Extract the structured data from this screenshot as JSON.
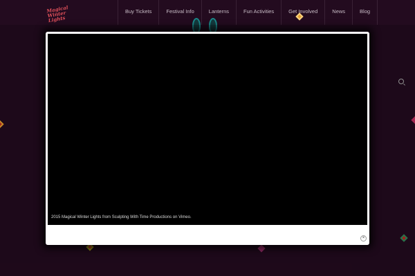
{
  "logo": {
    "text": "Magical Winter Lights"
  },
  "nav": {
    "items": [
      "Buy Tickets",
      "Festival Info",
      "Lanterns",
      "Fun Activities",
      "Get Involved",
      "News",
      "Blog"
    ]
  },
  "modal": {
    "caption": "2015 Magical Winter Lights from Sculpting With Time Productions on Vimeo.",
    "close_label": "×"
  },
  "colors": {
    "background": "#230b1f",
    "accent": "#e0505a"
  }
}
